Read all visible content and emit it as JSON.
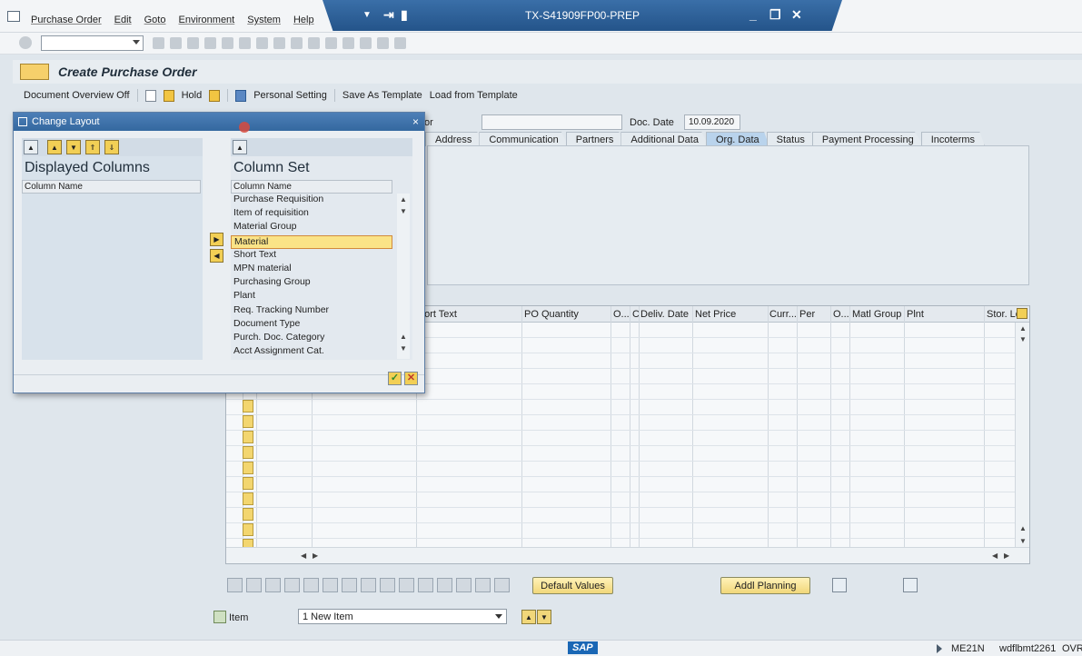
{
  "window": {
    "title": "TX-S41909FP00-PREP",
    "menu": [
      "Purchase Order",
      "Edit",
      "Goto",
      "Environment",
      "System",
      "Help"
    ]
  },
  "app": {
    "title": "Create Purchase Order",
    "toolbar": {
      "doc_overview": "Document Overview Off",
      "hold": "Hold",
      "personal_setting": "Personal Setting",
      "save_template": "Save As Template",
      "load_template": "Load from Template"
    }
  },
  "header": {
    "vendor_label_fragment": "or",
    "doc_date_label": "Doc. Date",
    "doc_date": "10.09.2020"
  },
  "tabs": [
    "Address",
    "Communication",
    "Partners",
    "Additional Data",
    "Org. Data",
    "Status",
    "Payment Processing",
    "Incoterms"
  ],
  "active_tab": "Org. Data",
  "grid": {
    "columns": [
      "hort Text",
      "PO Quantity",
      "O...",
      "C",
      "Deliv. Date",
      "Net Price",
      "Curr...",
      "Per",
      "O...",
      "Matl Group",
      "Plnt",
      "Stor. Lo"
    ]
  },
  "buttons": {
    "default_values": "Default Values",
    "addl_planning": "Addl Planning"
  },
  "item_select": {
    "label": "Item",
    "value": "1 New Item"
  },
  "status_bar": {
    "logo": "SAP",
    "transaction": "ME21N",
    "server": "wdflbmt2261",
    "mode": "OVR"
  },
  "dialog": {
    "title": "Change Layout",
    "displayed": {
      "title": "Displayed Columns",
      "column_header": "Column Name"
    },
    "column_set": {
      "title": "Column Set",
      "column_header": "Column Name",
      "items": [
        "Purchase Requisition",
        "Item of requisition",
        "Material Group",
        "Material",
        "Short Text",
        "MPN material",
        "Purchasing Group",
        "Plant",
        "Req. Tracking Number",
        "Document Type",
        "Purch. Doc. Category",
        "Acct Assignment Cat."
      ],
      "selected_index": 3
    }
  }
}
